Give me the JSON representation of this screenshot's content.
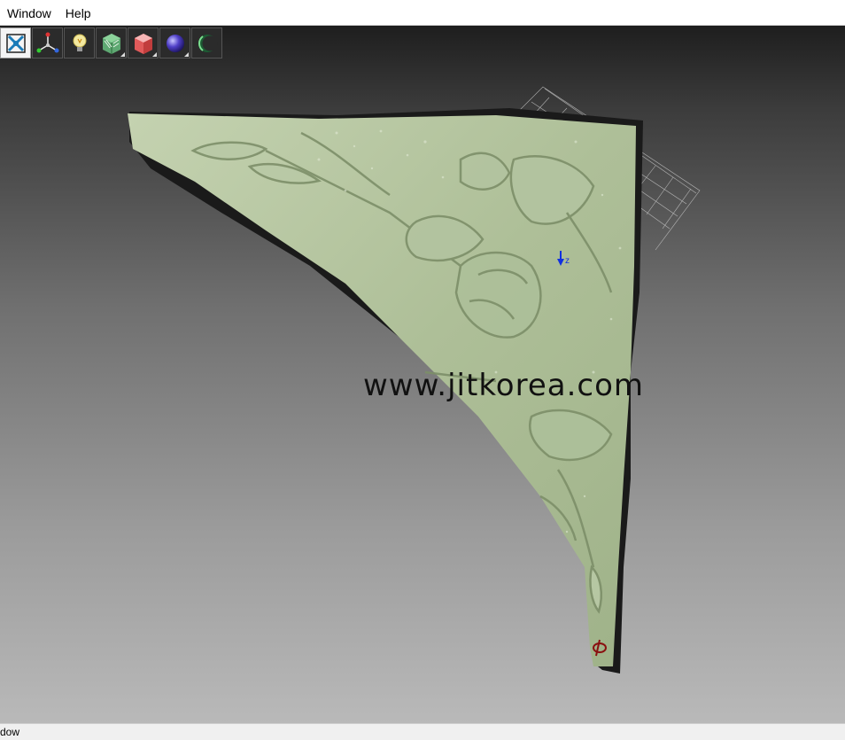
{
  "menubar": {
    "items": [
      {
        "label": "Window"
      },
      {
        "label": "Help"
      }
    ]
  },
  "toolbar": {
    "buttons": [
      {
        "icon": "fit-view-icon",
        "active": true
      },
      {
        "icon": "axis-view-icon"
      },
      {
        "icon": "light-bulb-icon"
      },
      {
        "icon": "shaded-cube-icon"
      },
      {
        "icon": "red-cube-icon"
      },
      {
        "icon": "sphere-icon"
      },
      {
        "icon": "crescent-icon"
      }
    ]
  },
  "viewport": {
    "axis_label": "z",
    "watermark": "www.jitkorea.com",
    "model_color": "#b8c9a4"
  },
  "statusbar": {
    "text": "dow"
  }
}
